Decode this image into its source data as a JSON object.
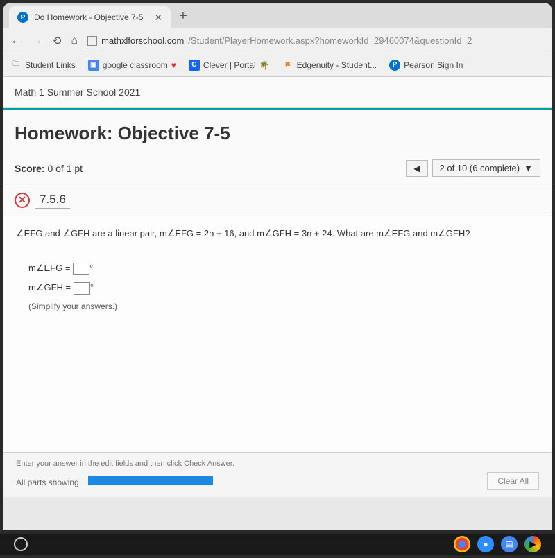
{
  "tab": {
    "title": "Do Homework - Objective 7-5"
  },
  "url": {
    "domain": "mathxlforschool.com",
    "path": "/Student/PlayerHomework.aspx?homeworkId=29460074&questionId=2"
  },
  "bookmarks": {
    "student_links": "Student Links",
    "google_classroom": "google classroom",
    "clever": "Clever | Portal",
    "edgenuity": "Edgenuity - Student...",
    "pearson": "Pearson Sign In"
  },
  "course": "Math 1 Summer School 2021",
  "homework": {
    "title": "Homework: Objective 7-5",
    "score_label": "Score:",
    "score_value": "0 of 1 pt",
    "progress": "2 of 10 (6 complete)",
    "question_number": "7.5.6"
  },
  "question": {
    "prompt": "∠EFG and ∠GFH are a linear pair, m∠EFG = 2n + 16, and m∠GFH = 3n + 24. What are m∠EFG and m∠GFH?",
    "line1_prefix": "m∠EFG =",
    "line1_suffix": "°",
    "line2_prefix": "m∠GFH =",
    "line2_suffix": "°",
    "simplify": "(Simplify your answers.)"
  },
  "footer": {
    "instruction": "Enter your answer in the edit fields and then click Check Answer.",
    "parts_label": "All parts showing",
    "clear": "Clear All"
  }
}
